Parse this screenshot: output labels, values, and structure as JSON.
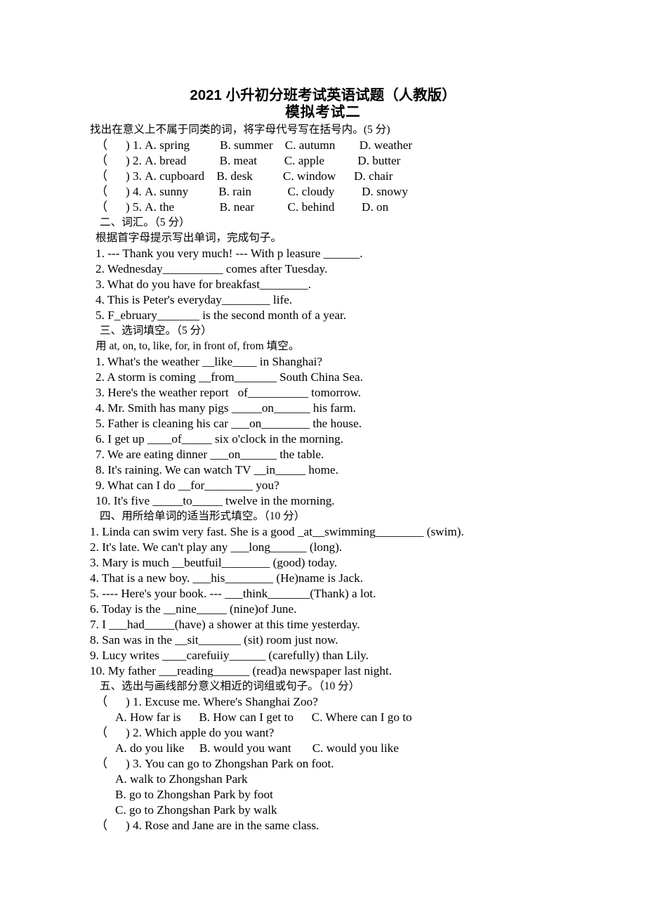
{
  "document": {
    "title_line_1": "2021 小升初分班考试英语试题（人教版）",
    "title_line_2": "模拟考试二"
  },
  "section_1": {
    "instruction": "找出在意义上不属于同类的词，将字母代号写在括号内。(5 分)",
    "items": [
      "（      ) 1. A. spring          B. summer    C. autumn        D. weather",
      "（      ) 2. A. bread           B. meat         C. apple           D. butter",
      "（      ) 3. A. cupboard    B. desk          C. window      D. chair",
      "（      ) 4. A. sunny          B. rain            C. cloudy         D. snowy",
      "（      ) 5. A. the               B. near           C. behind         D. on"
    ]
  },
  "section_2": {
    "heading": "二、词汇。（5 分）",
    "instruction": "根据首字母提示写出单词，完成句子。",
    "items": [
      "1. --- Thank you very much! --- With p leasure ______.",
      "2. Wednesday__________ comes after Tuesday.",
      "3. What do you have for breakfast________.",
      "4. This is Peter's everyday________ life.",
      "5. F_ebruary_______ is the second month of a year."
    ]
  },
  "section_3": {
    "heading": "三、选词填空。（5 分）",
    "instruction": "用 at, on, to, like, for, in front of, from 填空。",
    "items": [
      "1. What's the weather __like____ in Shanghai?",
      "2. A storm is coming __from_______ South China Sea.",
      "3. Here's the weather report   of__________ tomorrow.",
      "4. Mr. Smith has many pigs _____on______ his farm.",
      "5. Father is cleaning his car ___on________ the house.",
      "6. I get up ____of_____ six o'clock in the morning.",
      "7. We are eating dinner ___on______ the table.",
      "8. It's raining. We can watch TV __in_____ home.",
      "9. What can I do __for________ you?",
      "10. It's five _____to_____ twelve in the morning."
    ]
  },
  "section_4": {
    "heading": "四、用所给单词的适当形式填空。（10 分）",
    "items": [
      "1. Linda can swim very fast. She is a good _at__swimming________ (swim).",
      "2. It's late. We can't play any ___long______ (long).",
      "3. Mary is much __beutfuil________ (good) today.",
      "4. That is a new boy. ___his________ (He)name is Jack.",
      "5. ---- Here's your book. --- ___think_______(Thank) a lot.",
      "6. Today is the __nine_____ (nine)of June.",
      "7. I ___had_____(have) a shower at this time yesterday.",
      "8. San was in the __sit_______ (sit) room just now.",
      "9. Lucy writes ____carefuiiy______ (carefully) than Lily.",
      "10. My father ___reading______ (read)a newspaper last night."
    ]
  },
  "section_5": {
    "heading": "五、选出与画线部分意义相近的词组或句子。（10 分）",
    "questions": [
      {
        "stem": "（      ) 1. Excuse me. Where's Shanghai Zoo?",
        "choices": [
          "A. How far is      B. How can I get to      C. Where can I go to"
        ]
      },
      {
        "stem": "（      ) 2. Which apple do you want?",
        "choices": [
          "A. do you like     B. would you want       C. would you like"
        ]
      },
      {
        "stem": "（      ) 3. You can go to Zhongshan Park on foot.",
        "choices": [
          "A. walk to Zhongshan Park",
          "B. go to Zhongshan Park by foot",
          "C. go to Zhongshan Park by walk"
        ]
      },
      {
        "stem": "（      ) 4. Rose and Jane are in the same class.",
        "choices": []
      }
    ]
  }
}
